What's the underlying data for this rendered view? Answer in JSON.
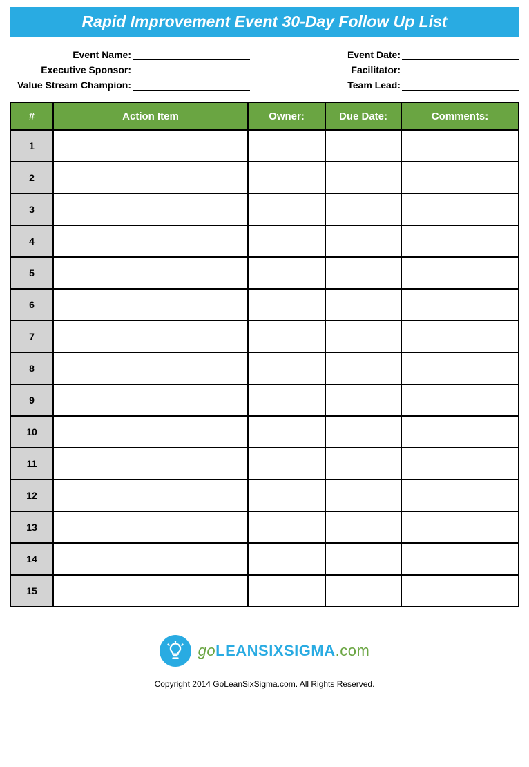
{
  "title": "Rapid Improvement Event 30-Day Follow Up List",
  "meta": {
    "left": [
      {
        "label": "Event Name:",
        "value": ""
      },
      {
        "label": "Executive Sponsor:",
        "value": ""
      },
      {
        "label": "Value Stream Champion:",
        "value": ""
      }
    ],
    "right": [
      {
        "label": "Event Date:",
        "value": ""
      },
      {
        "label": "Facilitator:",
        "value": ""
      },
      {
        "label": "Team Lead:",
        "value": ""
      }
    ]
  },
  "table": {
    "headers": {
      "num": "#",
      "action": "Action Item",
      "owner": "Owner:",
      "due": "Due Date:",
      "comments": "Comments:"
    },
    "rows": [
      {
        "num": "1",
        "action": "",
        "owner": "",
        "due": "",
        "comments": ""
      },
      {
        "num": "2",
        "action": "",
        "owner": "",
        "due": "",
        "comments": ""
      },
      {
        "num": "3",
        "action": "",
        "owner": "",
        "due": "",
        "comments": ""
      },
      {
        "num": "4",
        "action": "",
        "owner": "",
        "due": "",
        "comments": ""
      },
      {
        "num": "5",
        "action": "",
        "owner": "",
        "due": "",
        "comments": ""
      },
      {
        "num": "6",
        "action": "",
        "owner": "",
        "due": "",
        "comments": ""
      },
      {
        "num": "7",
        "action": "",
        "owner": "",
        "due": "",
        "comments": ""
      },
      {
        "num": "8",
        "action": "",
        "owner": "",
        "due": "",
        "comments": ""
      },
      {
        "num": "9",
        "action": "",
        "owner": "",
        "due": "",
        "comments": ""
      },
      {
        "num": "10",
        "action": "",
        "owner": "",
        "due": "",
        "comments": ""
      },
      {
        "num": "11",
        "action": "",
        "owner": "",
        "due": "",
        "comments": ""
      },
      {
        "num": "12",
        "action": "",
        "owner": "",
        "due": "",
        "comments": ""
      },
      {
        "num": "13",
        "action": "",
        "owner": "",
        "due": "",
        "comments": ""
      },
      {
        "num": "14",
        "action": "",
        "owner": "",
        "due": "",
        "comments": ""
      },
      {
        "num": "15",
        "action": "",
        "owner": "",
        "due": "",
        "comments": ""
      }
    ]
  },
  "logo": {
    "go": "go",
    "lean": "LEANSIXSIGMA",
    "com": ".com"
  },
  "copyright": "Copyright 2014 GoLeanSixSigma.com. All Rights Reserved."
}
